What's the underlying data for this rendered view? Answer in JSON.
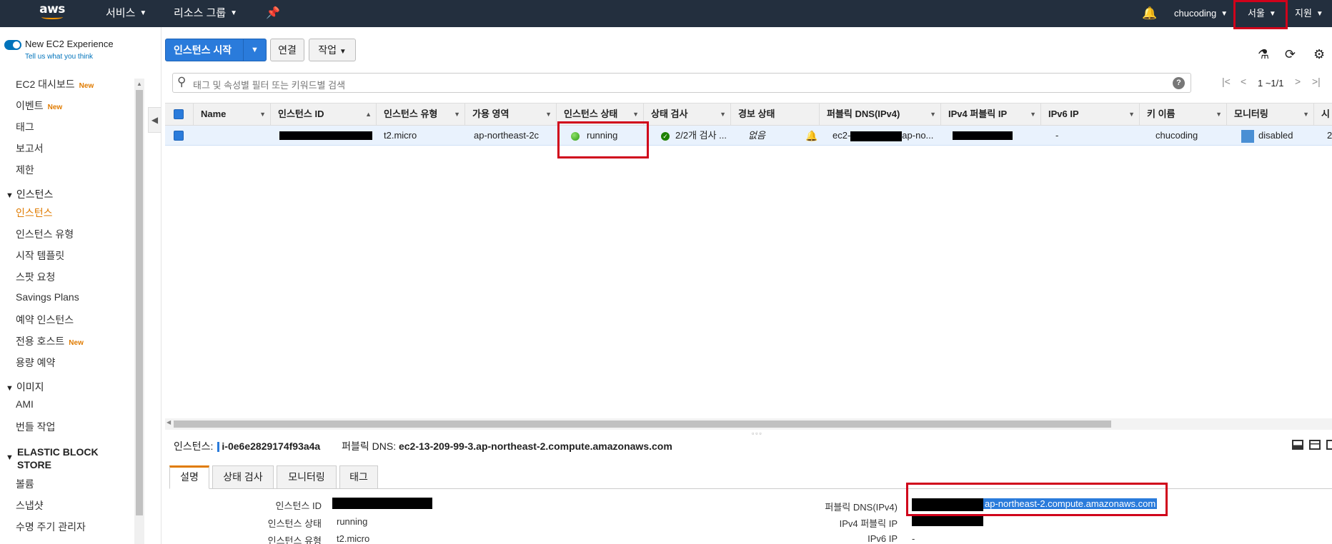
{
  "topnav": {
    "logo": "aws",
    "services": "서비스",
    "resource_groups": "리소스 그룹",
    "user": "chucoding",
    "region": "서울",
    "support": "지원"
  },
  "sidebar": {
    "new_experience": "New EC2 Experience",
    "tell_us": "Tell us what you think",
    "new_badge": "New",
    "items": [
      {
        "label": "EC2 대시보드",
        "new": true
      },
      {
        "label": "이벤트",
        "new": true
      },
      {
        "label": "태그"
      },
      {
        "label": "보고서"
      },
      {
        "label": "제한"
      }
    ],
    "instances_section": "인스턴스",
    "instances_items": [
      {
        "label": "인스턴스",
        "active": true
      },
      {
        "label": "인스턴스 유형"
      },
      {
        "label": "시작 템플릿"
      },
      {
        "label": "스팟 요청"
      },
      {
        "label": "Savings Plans"
      },
      {
        "label": "예약 인스턴스"
      },
      {
        "label": "전용 호스트",
        "new": true
      },
      {
        "label": "용량 예약"
      }
    ],
    "images_section": "이미지",
    "images_items": [
      {
        "label": "AMI"
      },
      {
        "label": "번들 작업"
      }
    ],
    "ebs_section": "ELASTIC BLOCK STORE",
    "ebs_items": [
      {
        "label": "볼륨"
      },
      {
        "label": "스냅샷"
      },
      {
        "label": "수명 주기 관리자"
      }
    ]
  },
  "toolbar": {
    "launch": "인스턴스 시작",
    "connect": "연결",
    "actions": "작업"
  },
  "search": {
    "placeholder": "태그 및 속성별 필터 또는 키워드별 검색",
    "help": "?"
  },
  "pager": {
    "text": "1 ~1/1"
  },
  "table": {
    "columns": [
      "Name",
      "인스턴스 ID",
      "인스턴스 유형",
      "가용 영역",
      "인스턴스 상태",
      "상태 검사",
      "경보 상태",
      "퍼블릭 DNS(IPv4)",
      "IPv4 퍼블릭 IP",
      "IPv6 IP",
      "키 이름",
      "모니터링",
      "시"
    ],
    "row": {
      "name": "",
      "type": "t2.micro",
      "zone": "ap-northeast-2c",
      "state": "running",
      "status_check": "2/2개 검사 ...",
      "alarm": "없음",
      "dns_prefix": "ec2-",
      "dns_suffix": "ap-no...",
      "ipv6": "-",
      "key": "chucoding",
      "monitoring": "disabled",
      "launch_time_partial": "2"
    }
  },
  "detail": {
    "instance_label": "인스턴스:",
    "instance_id": "i-0e6e2829174f93a4a",
    "dns_label": "퍼블릭 DNS:",
    "dns_value": "ec2-13-209-99-3.ap-northeast-2.compute.amazonaws.com",
    "tabs": [
      "설명",
      "상태 검사",
      "모니터링",
      "태그"
    ],
    "fields_left": [
      {
        "label": "인스턴스 ID",
        "value": ""
      },
      {
        "label": "인스턴스 상태",
        "value": "running"
      },
      {
        "label": "인스턴스 유형",
        "value": "t2.micro"
      }
    ],
    "fields_right": [
      {
        "label": "퍼블릭 DNS(IPv4)",
        "value": "ap-northeast-2.compute.amazonaws.com"
      },
      {
        "label": "IPv4 퍼블릭 IP",
        "value": ""
      },
      {
        "label": "IPv6 IP",
        "value": "-"
      }
    ]
  },
  "colors": {
    "nav_bg": "#232f3e",
    "primary": "#2a7bdb",
    "accent_orange": "#e07b00",
    "highlight_red": "#d0021b",
    "row_selected": "#e9f2fd"
  }
}
